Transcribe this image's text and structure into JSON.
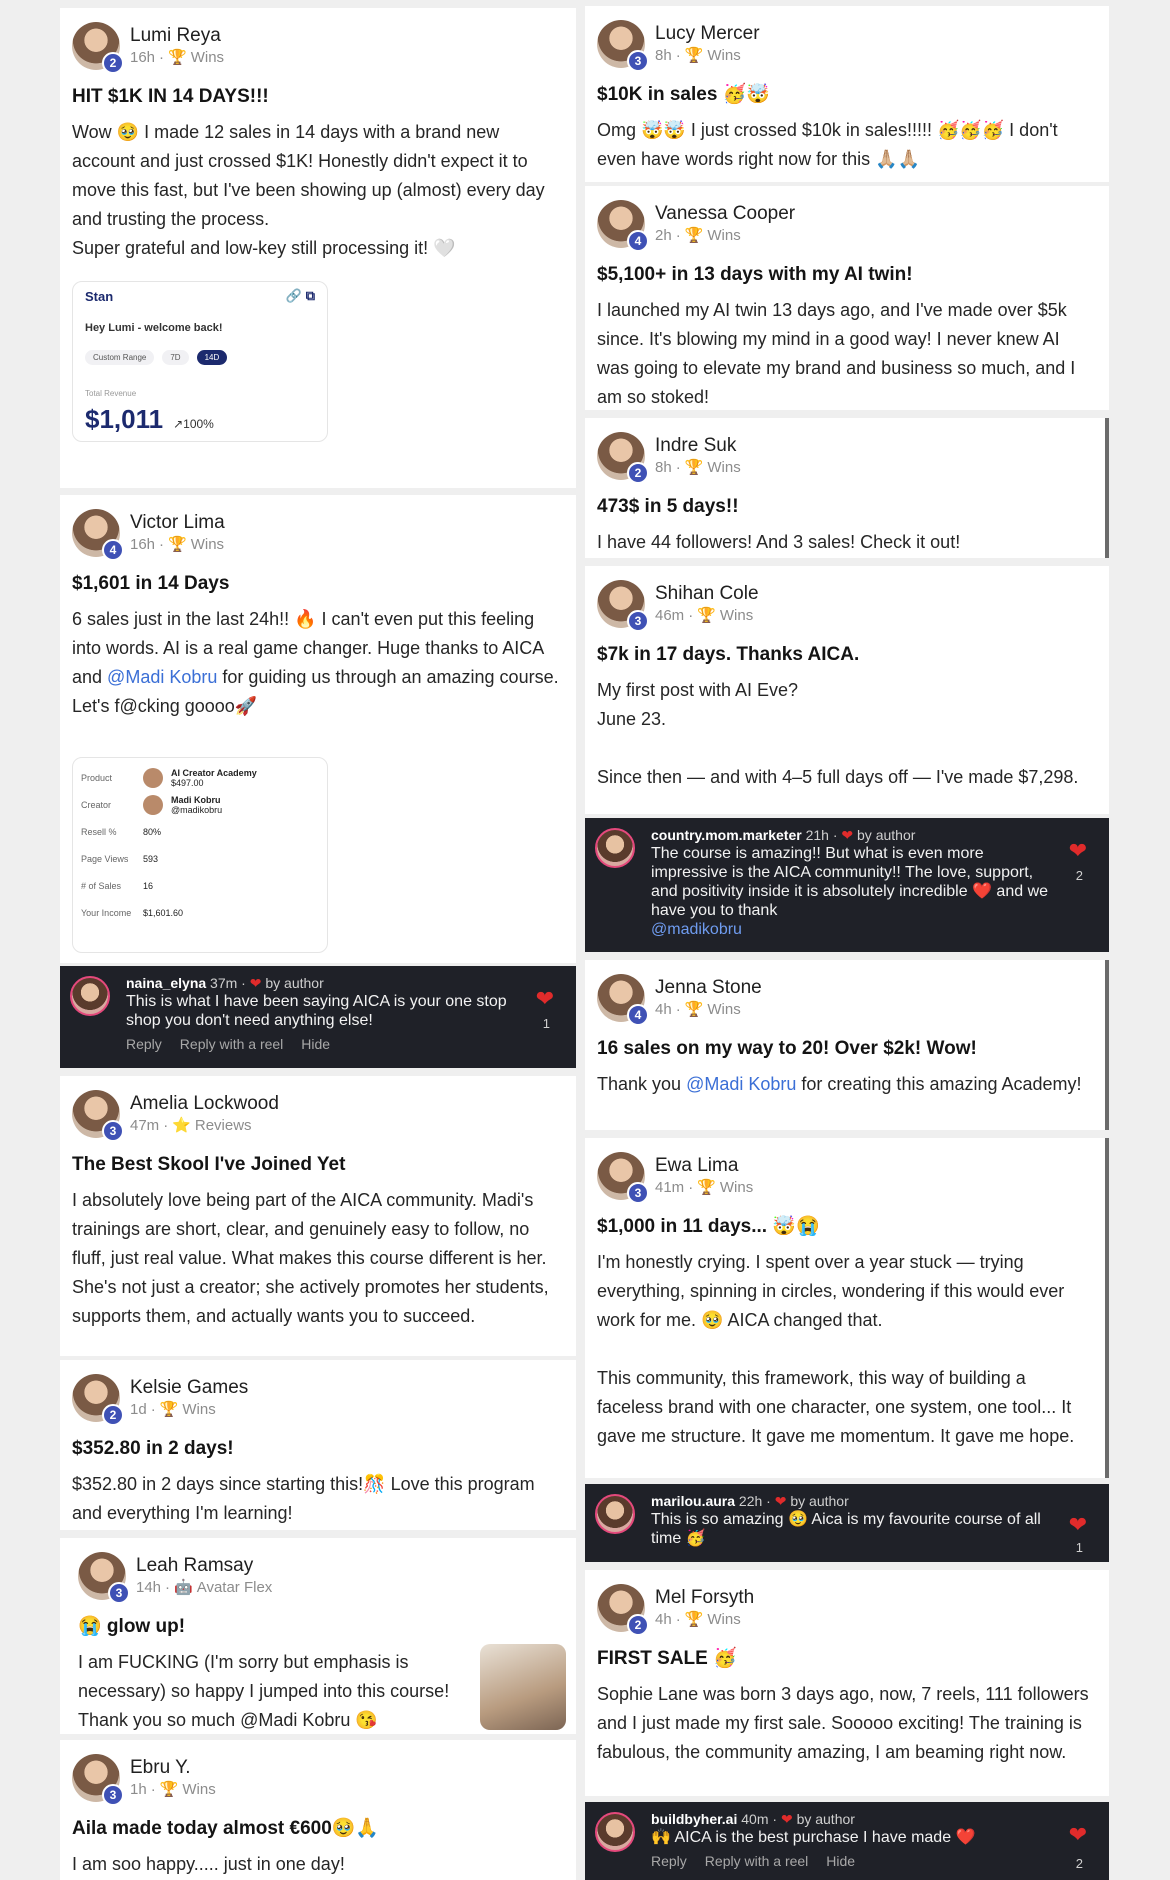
{
  "left": [
    {
      "name": "Lumi Reya",
      "level": "2",
      "time": "16h",
      "category": "Wins",
      "cat_icon": "trophy-icon",
      "title": "HIT $1K IN 14 DAYS!!!",
      "body": "Wow 🥹 I made 12 sales in 14 days with a brand new account and just crossed $1K! Honestly didn't expect it to move this fast, but I've been showing up (almost) every day and trusting the process.\nSuper grateful and low-key still processing it! 🤍"
    },
    {
      "name": "Victor Lima",
      "level": "4",
      "time": "16h",
      "category": "Wins",
      "cat_icon": "trophy-icon",
      "title": "$1,601 in 14 Days",
      "body_a": "6 sales just in the last 24h!! 🔥 I can't even put this feeling into words. AI is a real game changer. Huge thanks to AICA and ",
      "mention": "@Madi Kobru",
      "body_b": " for guiding us through an amazing course. Let's f@cking goooo🚀"
    },
    {
      "name": "Amelia Lockwood",
      "level": "3",
      "time": "47m",
      "category": "Reviews",
      "cat_icon": "star-icon",
      "title": "The Best Skool I've Joined Yet",
      "body": "I absolutely love being part of the AICA community. Madi's trainings are short, clear, and genuinely easy to follow, no fluff, just real value. What makes this course different is her. She's not just a creator; she actively promotes her students, supports them, and actually wants you to succeed."
    },
    {
      "name": "Kelsie Games",
      "level": "2",
      "time": "1d",
      "category": "Wins",
      "cat_icon": "trophy-icon",
      "title": "$352.80 in 2 days!",
      "body": "$352.80 in 2 days since starting this!🎊 Love this program and everything I'm learning!"
    },
    {
      "name": "Leah Ramsay",
      "level": "3",
      "time": "14h",
      "category": "Avatar Flex",
      "cat_icon": "robot-icon",
      "title": "😭 glow up!",
      "body": "I am FUCKING (I'm sorry but emphasis is necessary) so happy I jumped into this course! Thank you so much @Madi Kobru 😘"
    },
    {
      "name": "Ebru Y.",
      "level": "3",
      "time": "1h",
      "category": "Wins",
      "cat_icon": "trophy-icon",
      "title": "Aila made today almost €600🥹🙏",
      "body": "I am soo happy..... just in one day!"
    }
  ],
  "right": [
    {
      "name": "Lucy Mercer",
      "level": "3",
      "time": "8h",
      "category": "Wins",
      "cat_icon": "trophy-icon",
      "title": "$10K in sales 🥳🤯",
      "body": "Omg 🤯🤯 I just crossed $10k in sales!!!!! 🥳🥳🥳 I don't even have words right now for this 🙏🏼🙏🏼"
    },
    {
      "name": "Vanessa Cooper",
      "level": "4",
      "time": "2h",
      "category": "Wins",
      "cat_icon": "trophy-icon",
      "title": "$5,100+ in 13 days with my AI twin!",
      "body": "I launched my AI twin 13 days ago, and I've made over $5k since. It's blowing my mind in a good way! I never knew AI was going to elevate my brand and business so much, and I am so stoked!"
    },
    {
      "name": "Indre Suk",
      "level": "2",
      "time": "8h",
      "category": "Wins",
      "cat_icon": "trophy-icon",
      "title": "473$ in 5 days!!",
      "body": "I have 44 followers! And 3 sales! Check it out!"
    },
    {
      "name": "Shihan Cole",
      "level": "3",
      "time": "46m",
      "category": "Wins",
      "cat_icon": "trophy-icon",
      "title": "$7k in 17 days. Thanks AICA.",
      "body": "My first post with AI Eve?\nJune 23.\n\nSince then — and with 4–5 full days off — I've made $7,298."
    },
    {
      "name": "Jenna Stone",
      "level": "4",
      "time": "4h",
      "category": "Wins",
      "cat_icon": "trophy-icon",
      "title": "16 sales on my way to 20! Over $2k! Wow!",
      "body_a": "Thank you ",
      "mention": "@Madi Kobru",
      "body_b": " for creating this amazing Academy!"
    },
    {
      "name": "Ewa Lima",
      "level": "3",
      "time": "41m",
      "category": "Wins",
      "cat_icon": "trophy-icon",
      "title": "$1,000 in 11 days... 🤯😭",
      "body": "I'm honestly crying. I spent over a year stuck — trying everything, spinning in circles, wondering if this would ever work for me. 🥹 AICA changed that.\n\nThis community, this framework, this way of building a faceless brand with one character, one system, one tool... It gave me structure. It gave me momentum. It gave me hope."
    },
    {
      "name": "Mel Forsyth",
      "level": "2",
      "time": "4h",
      "category": "Wins",
      "cat_icon": "trophy-icon",
      "title": "FIRST SALE 🥳",
      "body": "Sophie Lane was born 3 days ago, now, 7 reels, 111 followers and I just made my first sale. Sooooo exciting! The training is fabulous, the community amazing, I am beaming right now."
    }
  ],
  "comments": [
    {
      "user": "naina_elyna",
      "time": "37m",
      "by": "by author",
      "msg": "This is what I have been saying AICA is your one stop shop you don't need anything else!",
      "likes": "1",
      "actions": [
        "Reply",
        "Reply with a reel",
        "Hide"
      ]
    },
    {
      "user": "country.mom.marketer",
      "time": "21h",
      "by": "by author",
      "msg": "The course is amazing!! But what is even more impressive is the AICA community!! The love, support, and positivity inside it is absolutely incredible ❤️ and we have you to thank",
      "mention": "@madikobru",
      "likes": "2"
    },
    {
      "user": "marilou.aura",
      "time": "22h",
      "by": "by author",
      "msg": "This is so amazing 🥹 Aica is my favourite course of all time 🥳",
      "likes": "1"
    },
    {
      "user": "buildbyher.ai",
      "time": "40m",
      "by": "by author",
      "msg": "🙌 AICA is the best purchase I have made ❤️",
      "likes": "2",
      "actions": [
        "Reply",
        "Reply with a reel",
        "Hide"
      ]
    }
  ],
  "stan": {
    "brand": "Stan",
    "greeting": "Hey Lumi - welcome back!",
    "ranges": [
      "Custom Range",
      "7D",
      "14D"
    ],
    "revenue_label": "Total Revenue",
    "revenue": "$1,011",
    "growth": "↗100%"
  },
  "sale": {
    "rows": [
      {
        "k": "Product",
        "v": "AI Creator Academy",
        "sub": "$497.00"
      },
      {
        "k": "Creator",
        "v": "Madi Kobru",
        "sub": "@madikobru"
      },
      {
        "k": "Resell %",
        "v": "80%"
      },
      {
        "k": "Page Views",
        "v": "593"
      },
      {
        "k": "# of Sales",
        "v": "16"
      },
      {
        "k": "Your Income",
        "v": "$1,601.60"
      }
    ]
  },
  "colors": {
    "level_badge": "#3f51b5",
    "mention": "#3b6fd6",
    "comment_bg": "#1f2128",
    "heart": "#e02b2b"
  }
}
